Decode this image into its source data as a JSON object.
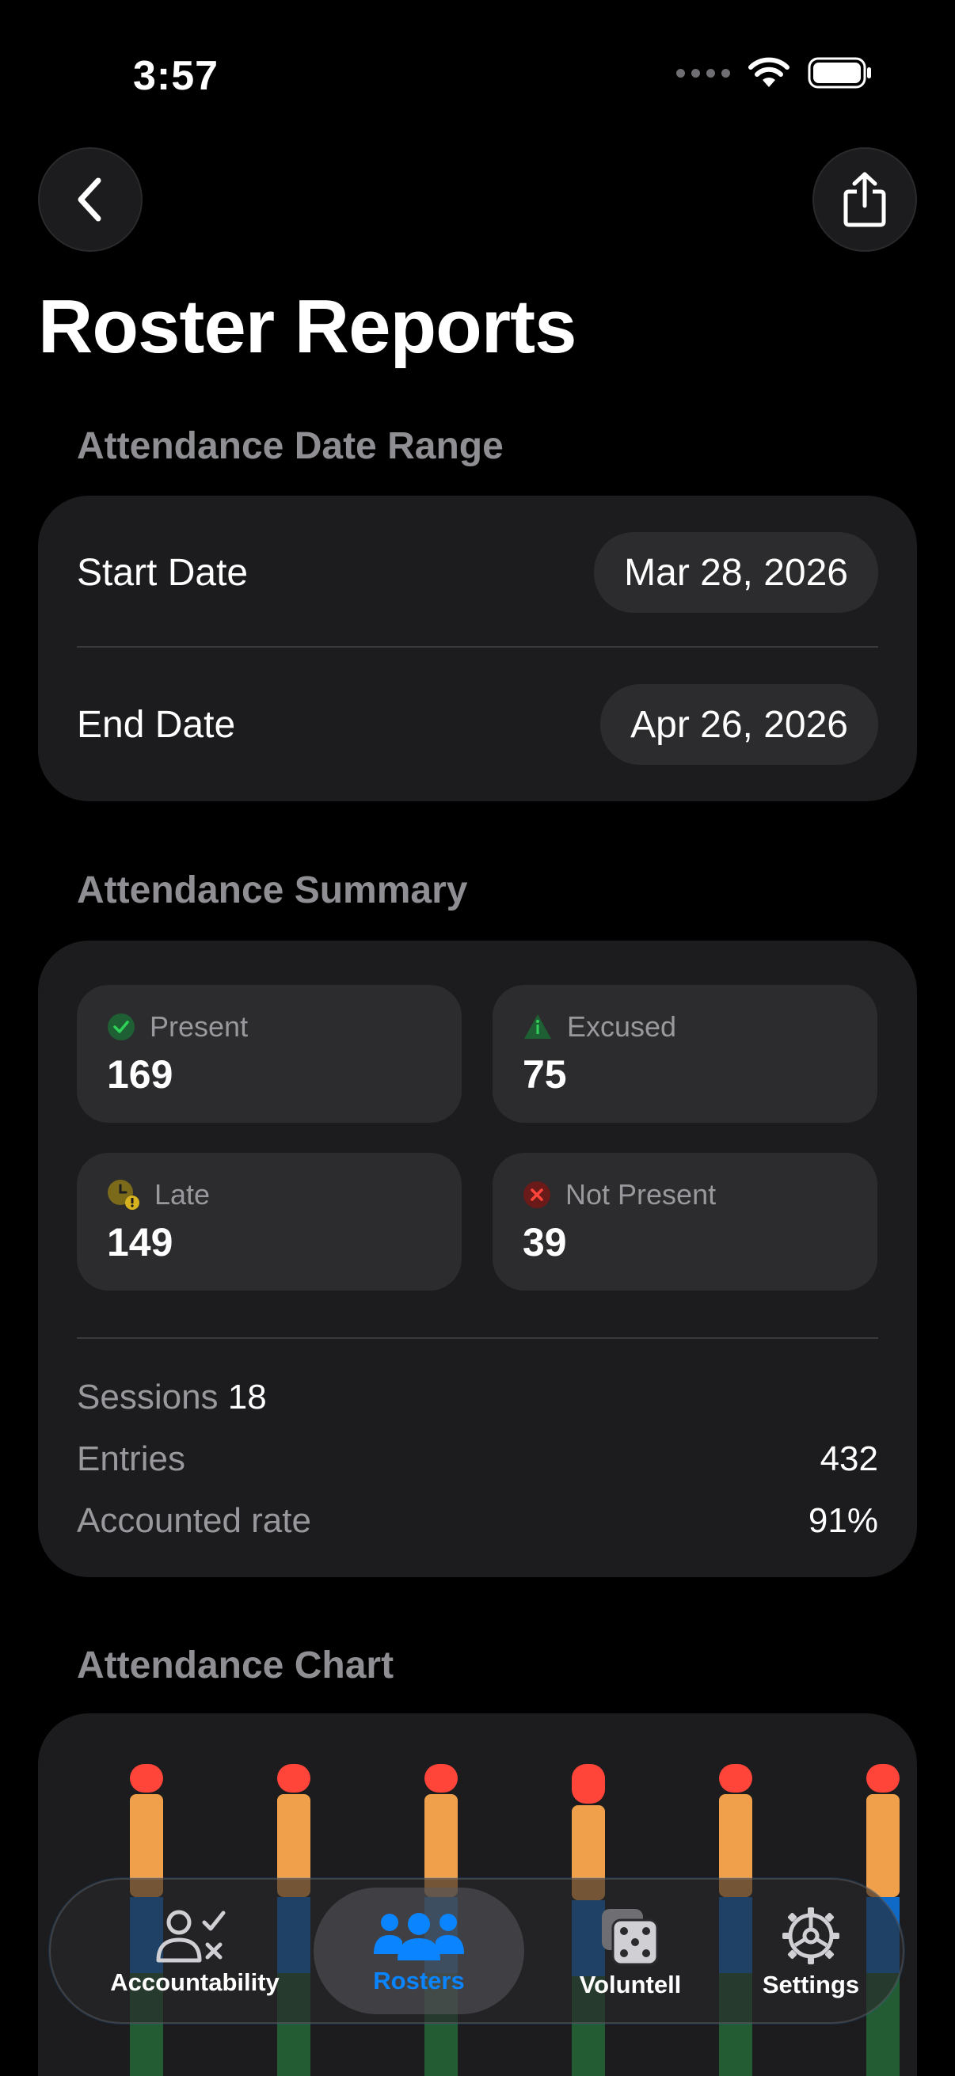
{
  "status_bar": {
    "time": "3:57"
  },
  "page": {
    "title": "Roster Reports"
  },
  "date_range": {
    "header": "Attendance Date Range",
    "start_label": "Start Date",
    "start_value": "Mar 28, 2026",
    "end_label": "End Date",
    "end_value": "Apr 26, 2026"
  },
  "summary": {
    "header": "Attendance Summary",
    "stats": [
      {
        "label": "Present",
        "value": "169",
        "icon": "checkmark-circle-icon",
        "color": "#30d158"
      },
      {
        "label": "Excused",
        "value": "75",
        "icon": "info-triangle-icon",
        "color": "#30d158"
      },
      {
        "label": "Late",
        "value": "149",
        "icon": "clock-warning-icon",
        "color": "#d6b21f"
      },
      {
        "label": "Not Present",
        "value": "39",
        "icon": "x-circle-icon",
        "color": "#ff453a"
      }
    ],
    "sessions_label": "Sessions",
    "sessions_value": "18",
    "entries_label": "Entries",
    "entries_value": "432",
    "rate_label": "Accounted rate",
    "rate_value": "91%"
  },
  "chart": {
    "header": "Attendance Chart",
    "colors": {
      "not_present": "#ff453a",
      "late": "#f0a04b",
      "excused": "#0a84ff",
      "present": "#30d158"
    }
  },
  "tab_bar": {
    "tabs": [
      {
        "label": "Accountability",
        "icon": "person-checklist-icon",
        "active": false
      },
      {
        "label": "Rosters",
        "icon": "people-group-icon",
        "active": true
      },
      {
        "label": "Voluntell",
        "icon": "dice-icon",
        "active": false
      },
      {
        "label": "Settings",
        "icon": "gear-icon",
        "active": false
      }
    ]
  }
}
